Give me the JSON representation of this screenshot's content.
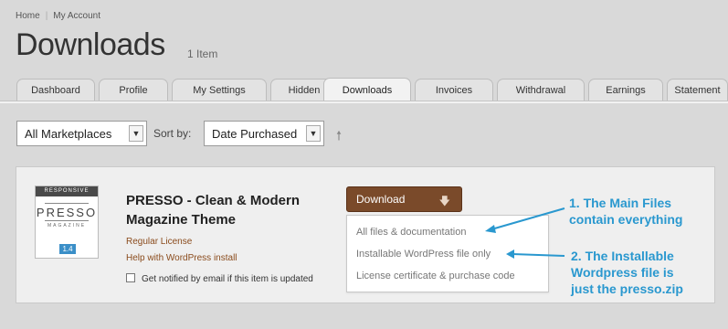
{
  "breadcrumb": {
    "home": "Home",
    "account": "My Account"
  },
  "page": {
    "title": "Downloads",
    "count": "1 Item"
  },
  "tabs": [
    "Dashboard",
    "Profile",
    "My Settings",
    "Hidden",
    "Downloads",
    "Invoices",
    "Withdrawal",
    "Earnings",
    "Statement"
  ],
  "active_tab": "Downloads",
  "filters": {
    "marketplace": "All Marketplaces",
    "sort_label": "Sort by:",
    "sort_value": "Date Purchased"
  },
  "item": {
    "thumb_band": "RESPONSIVE",
    "thumb_word": "PRESSO",
    "thumb_sub": "MAGAZINE",
    "thumb_version": "1.4",
    "title": "PRESSO - Clean & Modern Magazine Theme",
    "license": "Regular License",
    "help": "Help with WordPress install",
    "notify": "Get notified by email if this item is updated"
  },
  "download": {
    "label": "Download",
    "menu": [
      "All files & documentation",
      "Installable WordPress file only",
      "License certificate & purchase code"
    ]
  },
  "annotations": {
    "first_line1": "1. The Main Files",
    "first_line2": "contain everything",
    "second_line1": "2. The Installable",
    "second_line2": "Wordpress file is",
    "second_line3": "just the presso.zip"
  },
  "colors": {
    "annotation": "#2a98cf",
    "download_button": "#7a4a2a",
    "link": "#8a4b1c"
  }
}
